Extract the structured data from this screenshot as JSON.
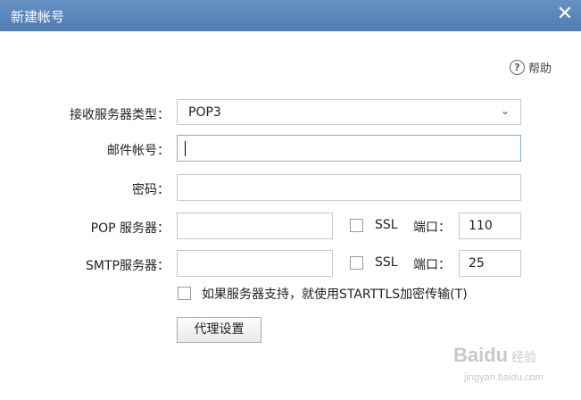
{
  "window": {
    "title": "新建帐号",
    "close_glyph": "✕"
  },
  "help": {
    "icon_glyph": "?",
    "label": "帮助"
  },
  "form": {
    "server_type": {
      "label": "接收服务器类型：",
      "value": "POP3",
      "chevron": "⌄"
    },
    "email": {
      "label": "邮件帐号：",
      "value": ""
    },
    "password": {
      "label": "密码：",
      "value": ""
    },
    "pop": {
      "label": "POP 服务器：",
      "value": "",
      "ssl_label": "SSL",
      "port_label": "端口：",
      "port_value": "110",
      "ssl_checked": false
    },
    "smtp": {
      "label": "SMTP服务器：",
      "value": "",
      "ssl_label": "SSL",
      "port_label": "端口：",
      "port_value": "25",
      "ssl_checked": false
    },
    "starttls": {
      "label": "如果服务器支持，就使用STARTTLS加密传输(T)",
      "checked": false
    },
    "proxy_button": "代理设置"
  },
  "watermark": {
    "brand": "Baidu",
    "suffix": "经验",
    "url": "jingyan.baidu.com"
  }
}
